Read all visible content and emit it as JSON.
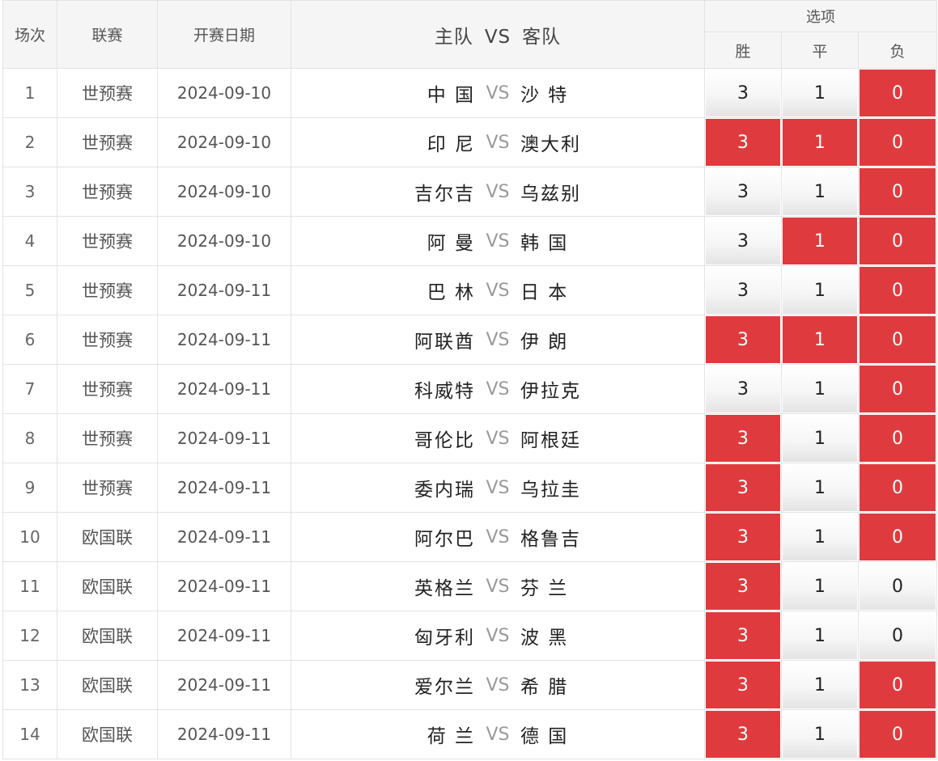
{
  "header": {
    "index": "场次",
    "league": "联赛",
    "date": "开赛日期",
    "home": "主队",
    "vs": "VS",
    "away": "客队",
    "options": "选项",
    "win": "胜",
    "draw": "平",
    "lose": "负"
  },
  "colors": {
    "selected": "#df3b3e",
    "header_bg": "#f5f5f5"
  },
  "rows": [
    {
      "index": "1",
      "league": "世预赛",
      "date": "2024-09-10",
      "home": "中 国",
      "vs": "VS",
      "away": "沙 特",
      "win": "3",
      "draw": "1",
      "lose": "0",
      "sel": [
        false,
        false,
        true
      ]
    },
    {
      "index": "2",
      "league": "世预赛",
      "date": "2024-09-10",
      "home": "印 尼",
      "vs": "VS",
      "away": "澳大利",
      "win": "3",
      "draw": "1",
      "lose": "0",
      "sel": [
        true,
        true,
        true
      ]
    },
    {
      "index": "3",
      "league": "世预赛",
      "date": "2024-09-10",
      "home": "吉尔吉",
      "vs": "VS",
      "away": "乌兹别",
      "win": "3",
      "draw": "1",
      "lose": "0",
      "sel": [
        false,
        false,
        true
      ]
    },
    {
      "index": "4",
      "league": "世预赛",
      "date": "2024-09-10",
      "home": "阿 曼",
      "vs": "VS",
      "away": "韩 国",
      "win": "3",
      "draw": "1",
      "lose": "0",
      "sel": [
        false,
        true,
        true
      ]
    },
    {
      "index": "5",
      "league": "世预赛",
      "date": "2024-09-11",
      "home": "巴 林",
      "vs": "VS",
      "away": "日 本",
      "win": "3",
      "draw": "1",
      "lose": "0",
      "sel": [
        false,
        false,
        true
      ]
    },
    {
      "index": "6",
      "league": "世预赛",
      "date": "2024-09-11",
      "home": "阿联酋",
      "vs": "VS",
      "away": "伊 朗",
      "win": "3",
      "draw": "1",
      "lose": "0",
      "sel": [
        true,
        true,
        true
      ]
    },
    {
      "index": "7",
      "league": "世预赛",
      "date": "2024-09-11",
      "home": "科威特",
      "vs": "VS",
      "away": "伊拉克",
      "win": "3",
      "draw": "1",
      "lose": "0",
      "sel": [
        false,
        false,
        true
      ]
    },
    {
      "index": "8",
      "league": "世预赛",
      "date": "2024-09-11",
      "home": "哥伦比",
      "vs": "VS",
      "away": "阿根廷",
      "win": "3",
      "draw": "1",
      "lose": "0",
      "sel": [
        true,
        false,
        true
      ]
    },
    {
      "index": "9",
      "league": "世预赛",
      "date": "2024-09-11",
      "home": "委内瑞",
      "vs": "VS",
      "away": "乌拉圭",
      "win": "3",
      "draw": "1",
      "lose": "0",
      "sel": [
        true,
        false,
        true
      ]
    },
    {
      "index": "10",
      "league": "欧国联",
      "date": "2024-09-11",
      "home": "阿尔巴",
      "vs": "VS",
      "away": "格鲁吉",
      "win": "3",
      "draw": "1",
      "lose": "0",
      "sel": [
        true,
        false,
        true
      ]
    },
    {
      "index": "11",
      "league": "欧国联",
      "date": "2024-09-11",
      "home": "英格兰",
      "vs": "VS",
      "away": "芬 兰",
      "win": "3",
      "draw": "1",
      "lose": "0",
      "sel": [
        true,
        false,
        false
      ]
    },
    {
      "index": "12",
      "league": "欧国联",
      "date": "2024-09-11",
      "home": "匈牙利",
      "vs": "VS",
      "away": "波 黑",
      "win": "3",
      "draw": "1",
      "lose": "0",
      "sel": [
        true,
        false,
        false
      ]
    },
    {
      "index": "13",
      "league": "欧国联",
      "date": "2024-09-11",
      "home": "爱尔兰",
      "vs": "VS",
      "away": "希 腊",
      "win": "3",
      "draw": "1",
      "lose": "0",
      "sel": [
        true,
        false,
        true
      ]
    },
    {
      "index": "14",
      "league": "欧国联",
      "date": "2024-09-11",
      "home": "荷 兰",
      "vs": "VS",
      "away": "德 国",
      "win": "3",
      "draw": "1",
      "lose": "0",
      "sel": [
        true,
        false,
        true
      ]
    }
  ]
}
